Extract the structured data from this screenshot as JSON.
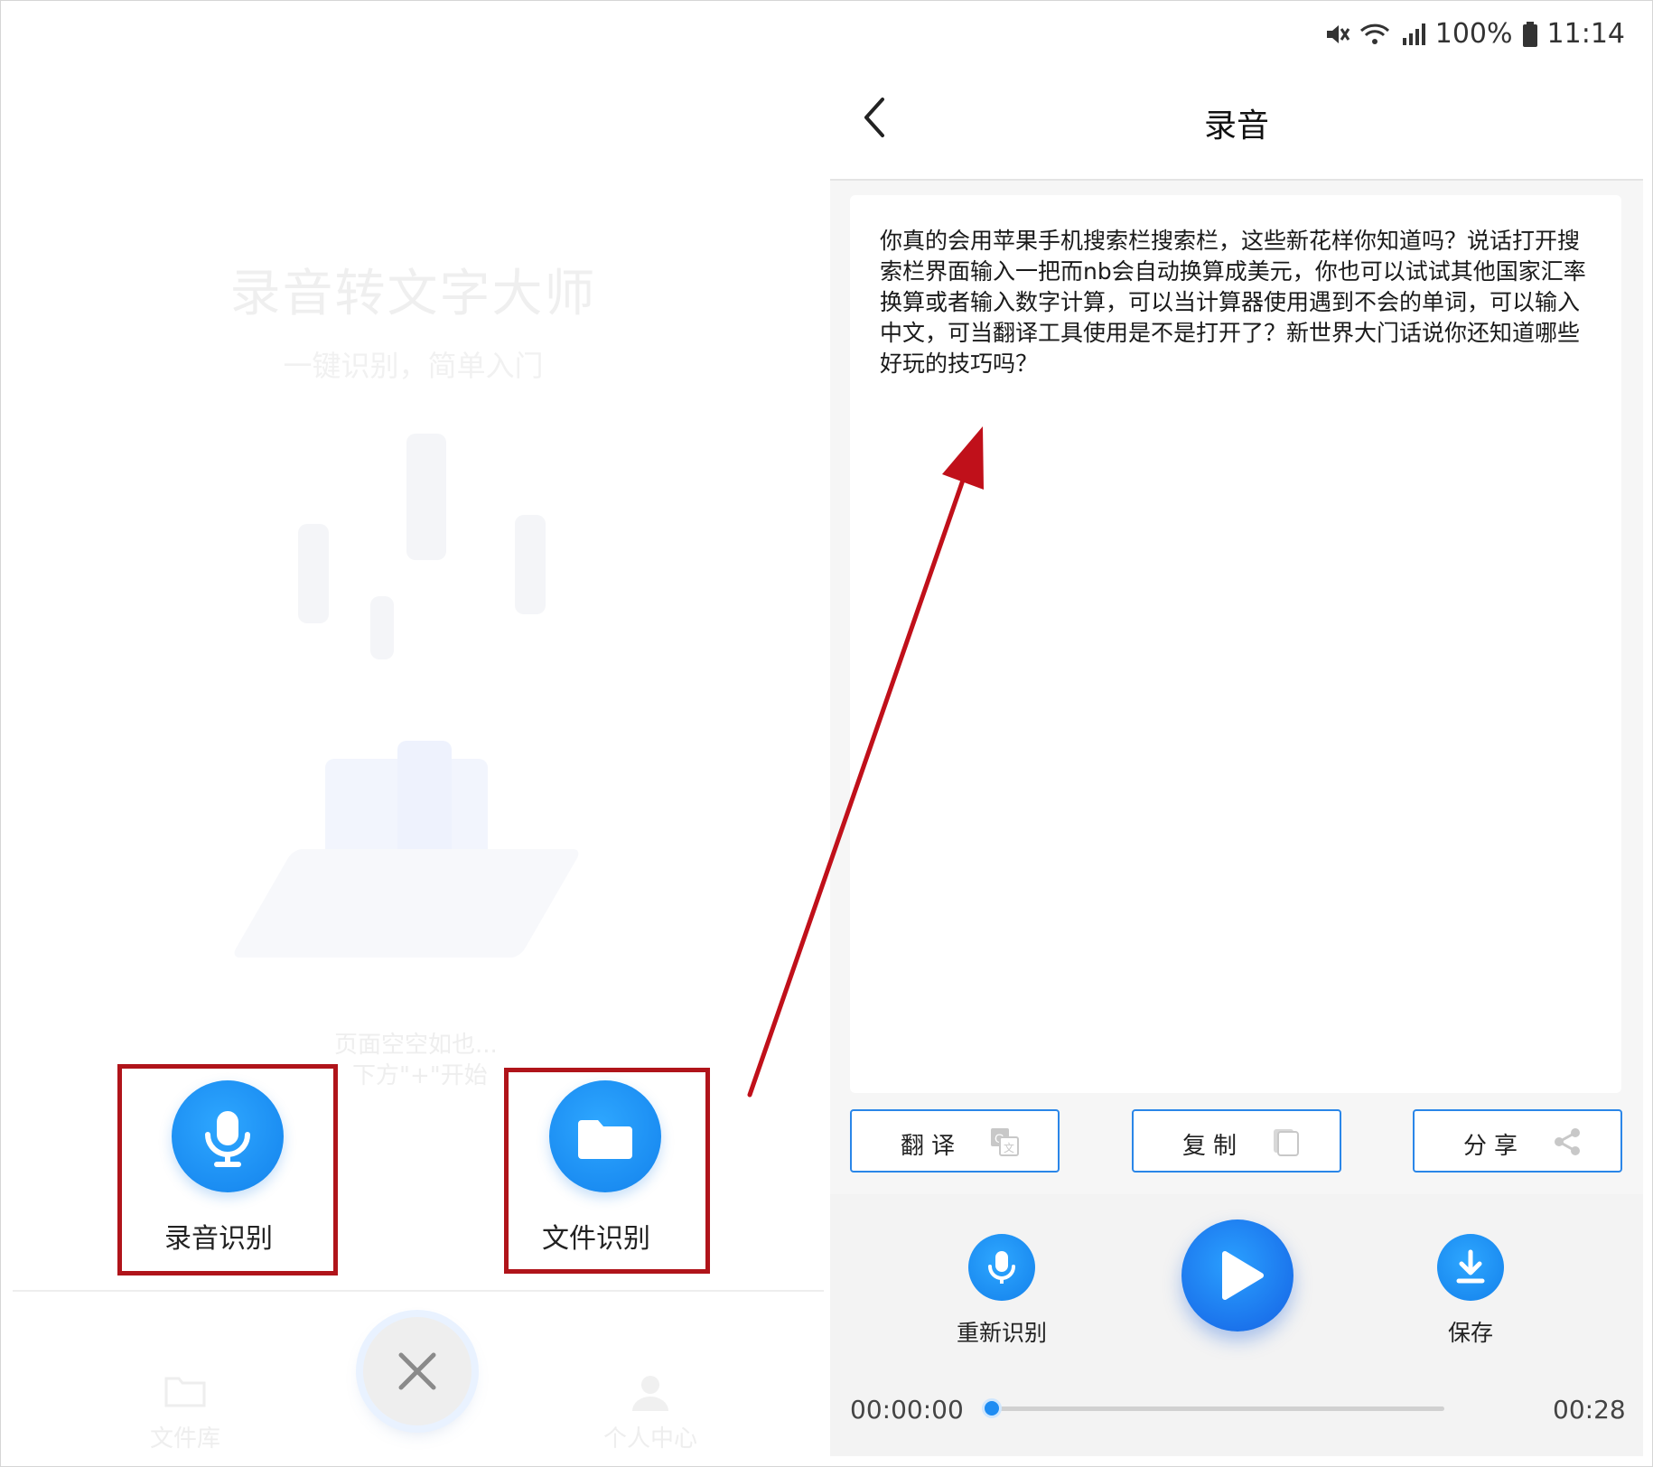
{
  "left_panel": {
    "bg_title": "录音转文字大师",
    "bg_subtitle": "一键识别，简单入门",
    "bg_empty_line1": "页面空空如也...",
    "bg_empty_line2": "下方\"+\"开始",
    "actions": [
      {
        "label": "录音识别",
        "icon": "microphone-icon"
      },
      {
        "label": "文件识别",
        "icon": "folder-icon"
      }
    ],
    "close_icon": "close-icon",
    "nav": [
      {
        "label": "文件库",
        "icon": "folder-icon"
      },
      {
        "label": "个人中心",
        "icon": "person-icon"
      }
    ]
  },
  "status_bar": {
    "battery": "100%",
    "time": "11:14"
  },
  "app_bar": {
    "back_icon": "chevron-left-icon",
    "title": "录音"
  },
  "transcript": "你真的会用苹果手机搜索栏搜索栏，这些新花样你知道吗？说话打开搜索栏界面输入一把而nb会自动换算成美元，你也可以试试其他国家汇率换算或者输入数字计算，可以当计算器使用遇到不会的单词，可以输入中文，可当翻译工具使用是不是打开了？新世界大门话说你还知道哪些好玩的技巧吗？",
  "pill_buttons": [
    {
      "label": "翻译",
      "icon": "translate-icon"
    },
    {
      "label": "复制",
      "icon": "copy-icon"
    },
    {
      "label": "分享",
      "icon": "share-icon"
    }
  ],
  "player": {
    "re_recognize_label": "重新识别",
    "save_label": "保存",
    "current_time": "00:00:00",
    "total_time": "00:28",
    "progress": 0
  },
  "colors": {
    "accent_blue": "#1b8df2",
    "highlight_red": "#b0141a",
    "arrow_red": "#c0101a"
  }
}
